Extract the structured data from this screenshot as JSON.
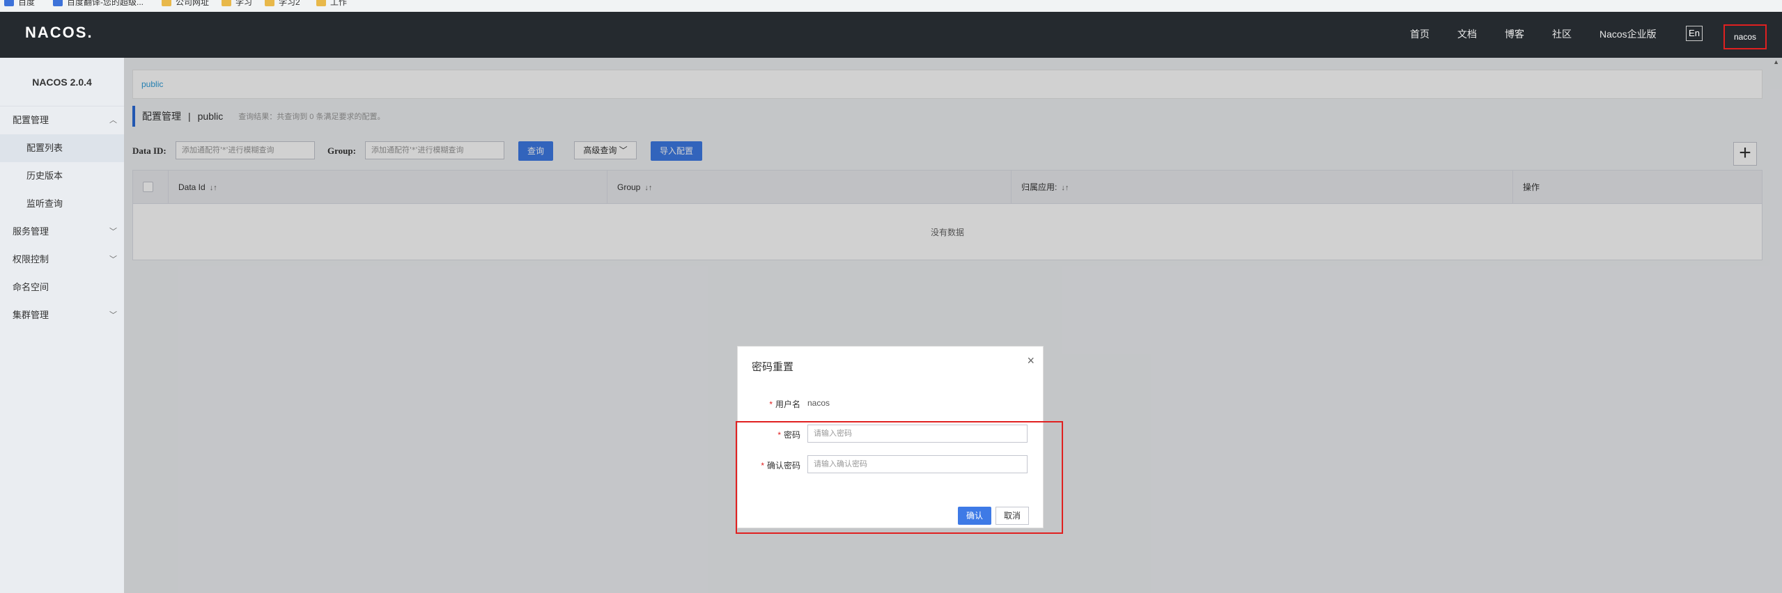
{
  "bookmarks": [
    "百度",
    "百度翻译-您的超级...",
    "公司网址",
    "学习",
    "学习2",
    "工作"
  ],
  "header": {
    "logo": "NACOS.",
    "nav": [
      "首页",
      "文档",
      "博客",
      "社区",
      "Nacos企业版"
    ],
    "lang": "En",
    "user": "nacos"
  },
  "sidebar": {
    "version": "NACOS 2.0.4",
    "items": [
      {
        "label": "配置管理",
        "chevron": "up"
      },
      {
        "label": "配置列表"
      },
      {
        "label": "历史版本"
      },
      {
        "label": "监听查询"
      },
      {
        "label": "服务管理",
        "chevron": "down"
      },
      {
        "label": "权限控制",
        "chevron": "down"
      },
      {
        "label": "命名空间"
      },
      {
        "label": "集群管理",
        "chevron": "down"
      }
    ]
  },
  "main": {
    "breadcrumb": "public",
    "title": "配置管理",
    "separator": "|",
    "namespace": "public",
    "query_hint": "查询结果：共查询到 0 条满足要求的配置。",
    "filters": {
      "data_id_label": "Data ID:",
      "data_id_placeholder": "添加通配符'*'进行模糊查询",
      "group_label": "Group:",
      "group_placeholder": "添加通配符'*'进行模糊查询",
      "query_button": "查询",
      "advanced_button": "高级查询",
      "import_button": "导入配置",
      "add_button": "+"
    },
    "table": {
      "columns": [
        "Data Id",
        "Group",
        "归属应用:",
        "操作"
      ],
      "empty_text": "没有数据"
    }
  },
  "modal": {
    "title": "密码重置",
    "close": "×",
    "username_label": "用户名",
    "username_value": "nacos",
    "password_label": "密码",
    "password_placeholder": "请输入密码",
    "confirm_label": "确认密码",
    "confirm_placeholder": "请输入确认密码",
    "required_mark": "*",
    "ok_button": "确认",
    "cancel_button": "取消"
  },
  "colors": {
    "header_bg": "#252a2f",
    "primary": "#3e7ae6",
    "highlight": "#e02020"
  }
}
